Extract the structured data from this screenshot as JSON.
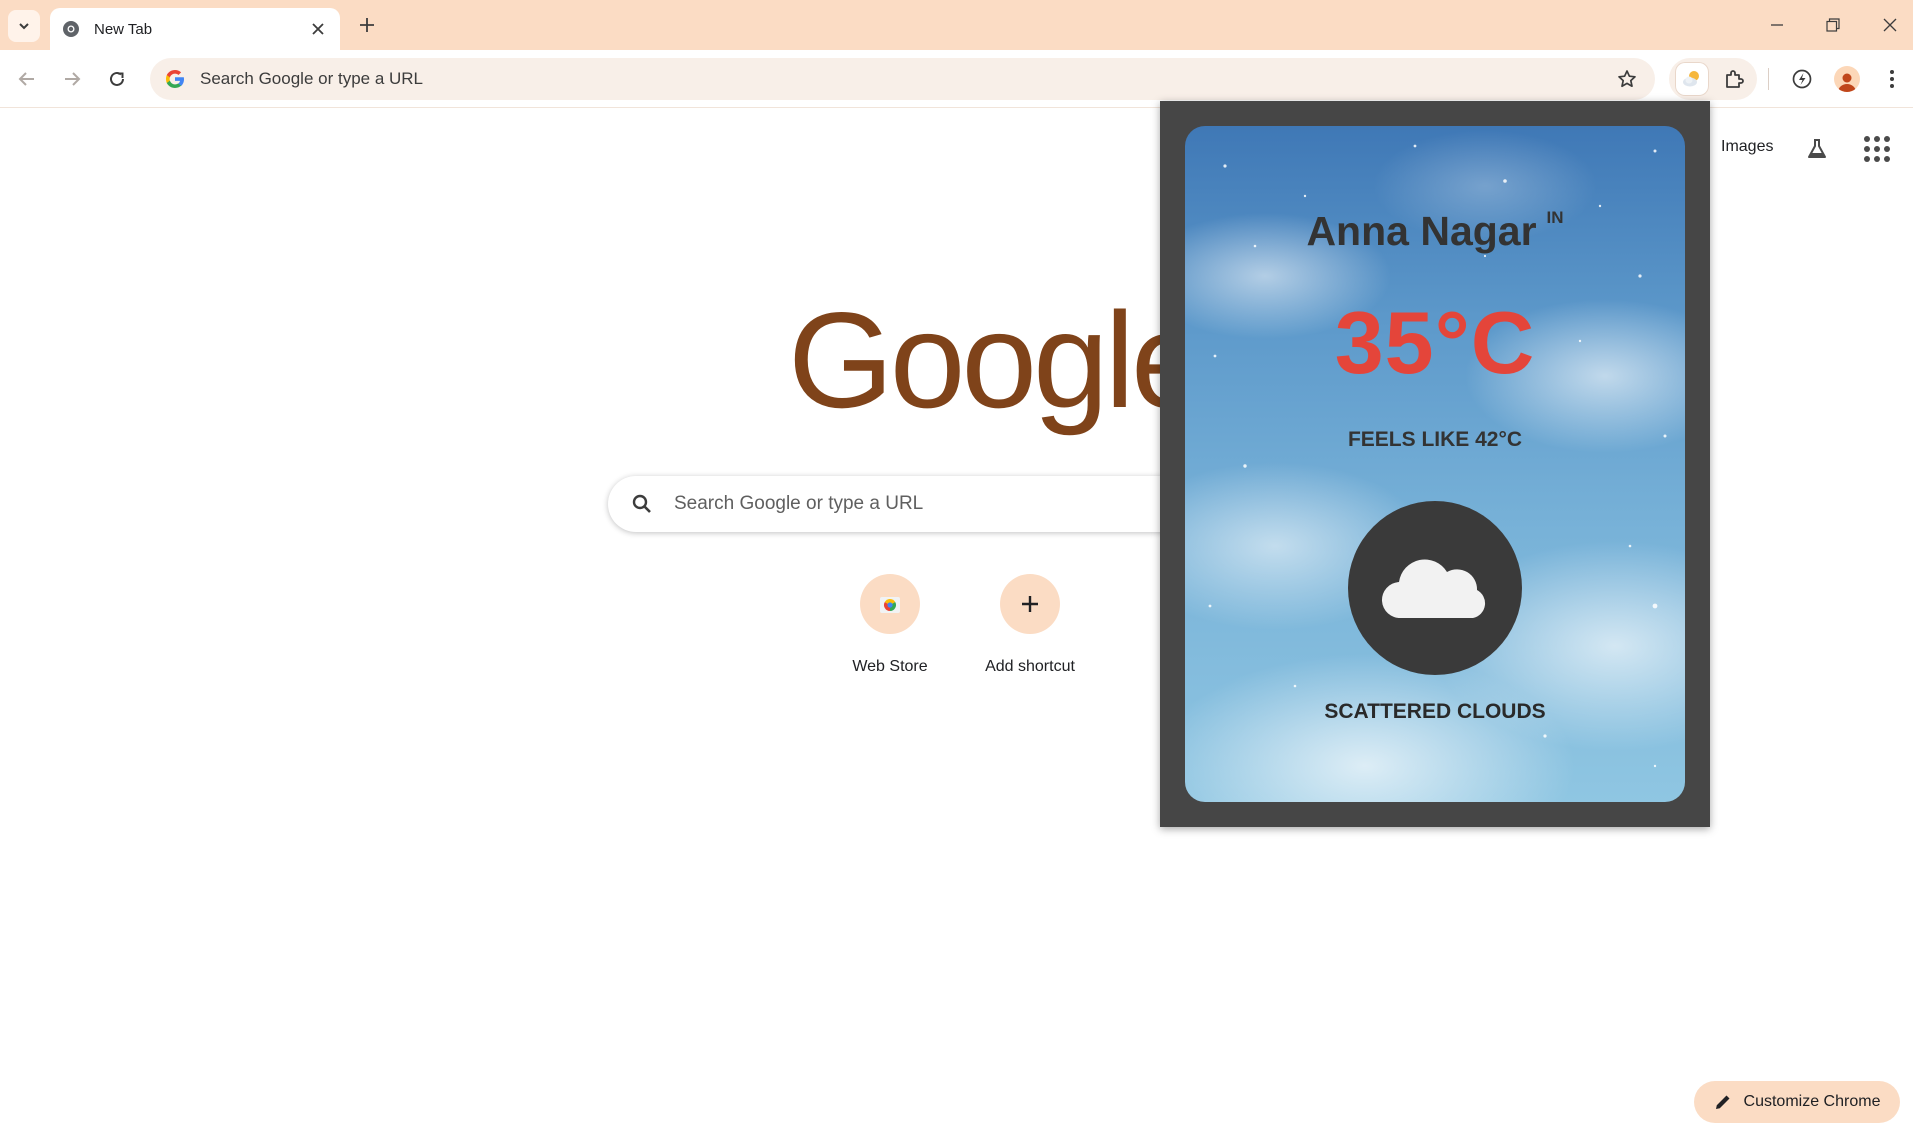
{
  "browser": {
    "tab": {
      "title": "New Tab"
    },
    "omnibox": {
      "placeholder": "Search Google or type a URL"
    }
  },
  "ntp": {
    "header_links": {
      "images": "Images"
    },
    "logo_text": "Google",
    "search": {
      "placeholder": "Search Google or type a URL"
    },
    "shortcuts": [
      {
        "label": "Web Store",
        "icon": "web-store-icon"
      },
      {
        "label": "Add shortcut",
        "icon": "plus-icon"
      }
    ],
    "customize_label": "Customize Chrome"
  },
  "weather": {
    "city": "Anna Nagar",
    "country": "IN",
    "temperature": "35°C",
    "feels_like": "FEELS LIKE 42°C",
    "description": "SCATTERED CLOUDS",
    "icon": "cloud-icon"
  },
  "colors": {
    "tabstrip": "#fbdcc4",
    "logo": "#7f431a",
    "temperature": "#e4453a",
    "popup_frame": "#464646"
  }
}
